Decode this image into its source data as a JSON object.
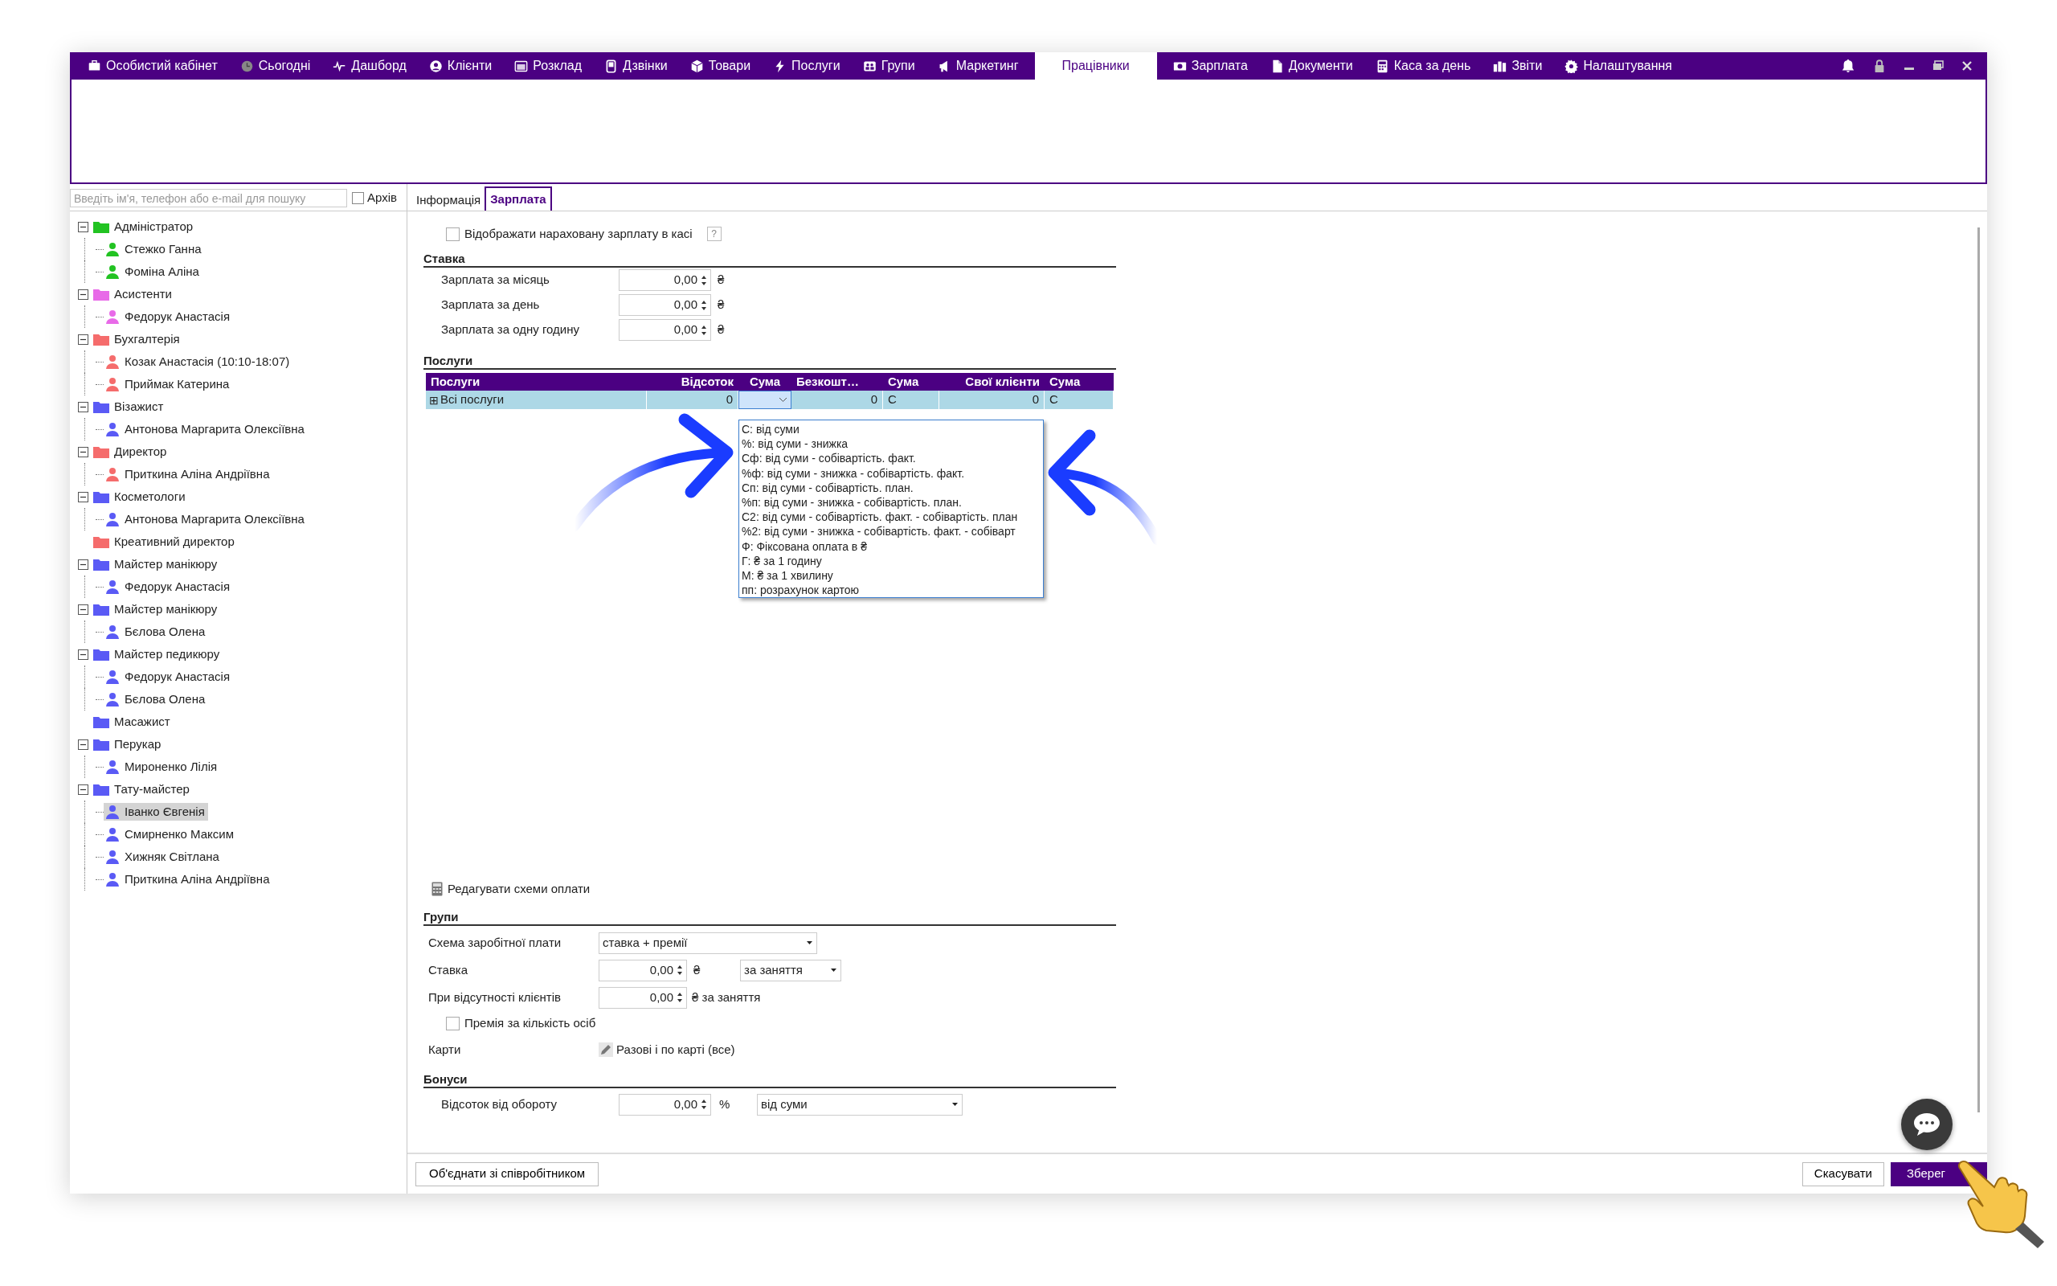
{
  "nav": [
    {
      "label": "Особистий кабінет",
      "selected": false
    },
    {
      "label": "Сьогодні",
      "selected": false
    },
    {
      "label": "Дашборд",
      "selected": false
    },
    {
      "label": "Клієнти",
      "selected": false
    },
    {
      "label": "Розклад",
      "selected": false
    },
    {
      "label": "Дзвінки",
      "selected": false
    },
    {
      "label": "Товари",
      "selected": false
    },
    {
      "label": "Послуги",
      "selected": false
    },
    {
      "label": "Групи",
      "selected": false
    },
    {
      "label": "Маркетинг",
      "selected": false
    },
    {
      "label": "Працівники",
      "selected": true
    },
    {
      "label": "Зарплата",
      "selected": false
    },
    {
      "label": "Документи",
      "selected": false
    },
    {
      "label": "Каса за день",
      "selected": false
    },
    {
      "label": "Звіти",
      "selected": false
    },
    {
      "label": "Налаштування",
      "selected": false
    }
  ],
  "sidebar": {
    "search": {
      "placeholder": "Введіть ім'я, телефон або e-mail для пошуку"
    },
    "archive": {
      "label": "Архів",
      "checked": false
    },
    "groups": [
      {
        "name": "Адміністратор",
        "color": "#22c322",
        "expanded": true,
        "children": [
          {
            "name": "Стежко Ганна",
            "selected": false
          },
          {
            "name": "Фоміна Аліна",
            "selected": false
          }
        ]
      },
      {
        "name": "Асистенти",
        "color": "#e86ae8",
        "expanded": true,
        "children": [
          {
            "name": "Федорук Анастасія",
            "selected": false
          }
        ]
      },
      {
        "name": "Бухгалтерія",
        "color": "#f56c6c",
        "expanded": true,
        "children": [
          {
            "name": "Козак Анастасія (10:10-18:07)",
            "selected": false
          },
          {
            "name": "Приймак Катерина",
            "selected": false
          }
        ]
      },
      {
        "name": "Візажист",
        "color": "#5a5af5",
        "expanded": true,
        "children": [
          {
            "name": "Антонова Маргарита Олексіївна",
            "selected": false
          }
        ]
      },
      {
        "name": "Директор",
        "color": "#f56c6c",
        "expanded": true,
        "children": [
          {
            "name": "Приткина Аліна Андріївна",
            "selected": false
          }
        ]
      },
      {
        "name": "Косметологи",
        "color": "#5a5af5",
        "expanded": true,
        "children": [
          {
            "name": "Антонова Маргарита Олексіївна",
            "selected": false
          }
        ]
      },
      {
        "name": "Креативний директор",
        "color": "#f56c6c"
      },
      {
        "name": "Майстер манікюру",
        "color": "#5a5af5",
        "expanded": true,
        "children": [
          {
            "name": "Федорук Анастасія",
            "selected": false
          }
        ]
      },
      {
        "name": "Майстер манікюру",
        "color": "#5a5af5",
        "expanded": true,
        "children": [
          {
            "name": "Бєлова Олена",
            "selected": false
          }
        ]
      },
      {
        "name": "Майстер педикюру",
        "color": "#5a5af5",
        "expanded": true,
        "children": [
          {
            "name": "Федорук Анастасія",
            "selected": false
          },
          {
            "name": "Бєлова Олена",
            "selected": false
          }
        ]
      },
      {
        "name": "Масажист",
        "color": "#5a5af5"
      },
      {
        "name": "Перукар",
        "color": "#5a5af5",
        "expanded": true,
        "children": [
          {
            "name": "Мироненко Лілія",
            "selected": false
          }
        ]
      },
      {
        "name": "Тату-майстер",
        "color": "#5a5af5",
        "expanded": true,
        "children": [
          {
            "name": "Іванко Євгенія",
            "selected": true
          },
          {
            "name": "Смирненко Максим",
            "selected": false
          },
          {
            "name": "Хижняк Світлана",
            "selected": false
          },
          {
            "name": "Приткина Аліна Андріївна",
            "selected": false
          }
        ]
      }
    ]
  },
  "tabs": [
    {
      "label": "Інформація",
      "selected": false
    },
    {
      "label": "Зарплата",
      "selected": true
    }
  ],
  "show_in_cash": {
    "label": "Відображати нараховану зарплату в касі",
    "checked": false,
    "help": "?"
  },
  "rate": {
    "title": "Ставка",
    "fields": [
      {
        "label": "Зарплата за місяць",
        "value": "0,00",
        "unit": "₴"
      },
      {
        "label": "Зарплата за день",
        "value": "0,00",
        "unit": "₴"
      },
      {
        "label": "Зарплата за одну годину",
        "value": "0,00",
        "unit": "₴"
      }
    ]
  },
  "services": {
    "title": "Послуги",
    "columns": [
      "Послуги",
      "Відсоток",
      "Сума",
      "Безкошт…",
      "Сума",
      "Свої клієнти",
      "Сума"
    ],
    "rows": [
      {
        "expander": "⊞",
        "cells": [
          "Всі послуги",
          "0",
          "",
          "0",
          "С",
          "0",
          "С"
        ]
      }
    ],
    "dropdown_options": [
      "С: від суми",
      "%: від суми - знижка",
      "Сф: від суми - собівартість. факт.",
      "%ф: від суми - знижка - собівартість. факт.",
      "Сп: від суми - собівартість. план.",
      "%п: від суми - знижка - собівартість. план.",
      "С2: від суми - собівартість. факт. - собівартість. план",
      "%2: від суми - знижка - собівартість. факт. - собіварт",
      "Ф: Фіксована оплата в ₴",
      "Г: ₴ за 1 годину",
      "М: ₴ за 1 хвилину",
      "пп: розрахунок картою"
    ]
  },
  "edit_schemes": "Редагувати схеми оплати",
  "groups_section": {
    "title": "Групи",
    "scheme_label": "Схема заробітної плати",
    "scheme_value": "ставка + премії",
    "rate_label": "Ставка",
    "rate_value": "0,00",
    "rate_unit": "₴",
    "rate_per": "за заняття",
    "absent_label": "При відсутності клієнтів",
    "absent_value": "0,00",
    "absent_unit": "₴ за заняття",
    "bonus_count": {
      "label": "Премія за кількість осіб",
      "checked": false
    },
    "cards_label": "Карти",
    "cards_value": "Разові і по карті (все)"
  },
  "bonuses": {
    "title": "Бонуси",
    "label": "Відсоток від обороту",
    "value": "0,00",
    "unit": "%",
    "basis": "від суми"
  },
  "footer": {
    "merge": "Об'єднати зі співробітником",
    "cancel": "Скасувати",
    "save": "Зберег"
  }
}
